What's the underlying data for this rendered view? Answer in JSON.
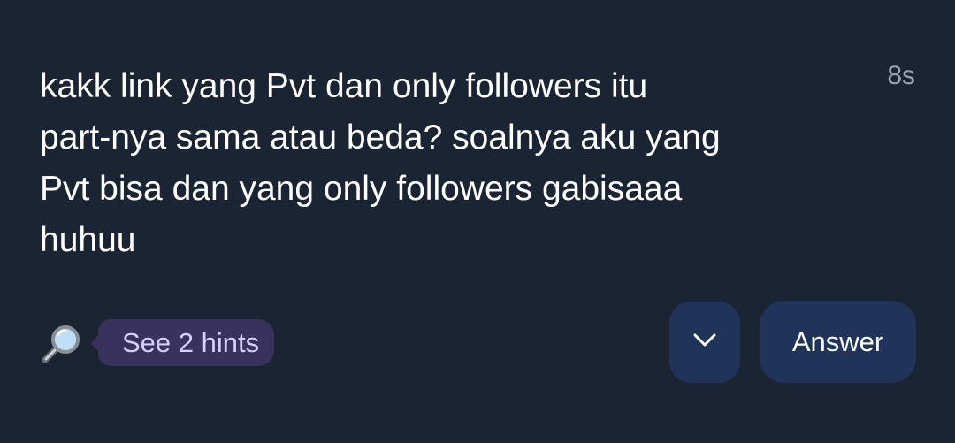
{
  "post": {
    "question": "kakk link yang Pvt dan only followers itu\npart-nya sama atau beda? soalnya aku yang\nPvt bisa dan yang only followers gabisaaa\nhuhuu",
    "timestamp": "8s"
  },
  "actions": {
    "hints_icon": "magnifying-glass-icon",
    "hints_label": "See 2 hints",
    "expand_icon": "chevron-down-icon",
    "answer_label": "Answer"
  },
  "colors": {
    "background": "#1b2433",
    "hint_chip": "#39325c",
    "hint_text": "#d6cdfa",
    "button_bg": "#1f3458",
    "text_primary": "#ffffff",
    "text_secondary": "#9aa4b3"
  }
}
